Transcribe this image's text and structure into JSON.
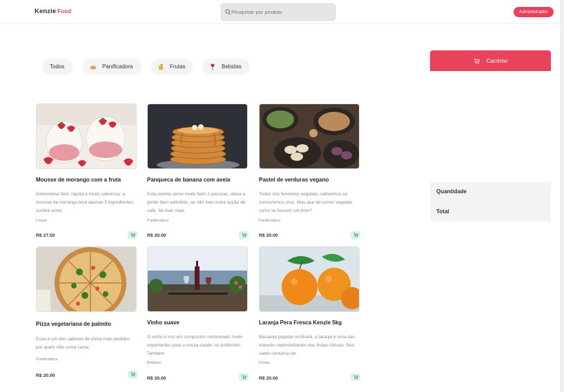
{
  "header": {
    "logo_main": "Kenzie",
    "logo_accent": "Food",
    "search_placeholder": "Pesquisar por produto",
    "admin_label": "Administrador"
  },
  "categories": [
    {
      "label": "Todos",
      "icon": ""
    },
    {
      "label": "Panificadora",
      "icon": "bread-icon"
    },
    {
      "label": "Frutas",
      "icon": "fruit-icon"
    },
    {
      "label": "Bebidas",
      "icon": "wine-icon"
    }
  ],
  "cart": {
    "title": "Carrinho",
    "quantity_label": "Quantidade",
    "total_label": "Total"
  },
  "products": [
    {
      "name": "Mousse de morango com a fruta",
      "description": "Sobremesa fácil, rápida e muito saborosa: a mousse de morango leva apenas 5 ingredientes; confira como",
      "category": "Frutas",
      "price": "R$ 27.50",
      "image": "strawberry-mousse"
    },
    {
      "name": "Panqueca de banana com aveia",
      "description": "Esta receita serve muito bem 2 pessoas, deixa a gente bem satisfeito, se não tiver outra opção de café. Se tiver mais",
      "category": "Panificadora",
      "price": "R$ 20.00",
      "image": "pancakes"
    },
    {
      "name": "Pastel de verduras vegano",
      "description": "Todos nós fervemos vegetais, salteamos ou consumimos crus. Mas que tal comer vegetais como se fossem um bolo?",
      "category": "Panificadora",
      "price": "R$ 20.00",
      "image": "dumplings"
    },
    {
      "name": "Pizza vegetariana de palmito",
      "description": "Esse é um dos sabores de pizza mais pedidos por quem não come carne",
      "category": "Panificadora",
      "price": "R$ 20.00",
      "image": "pizza"
    },
    {
      "name": "Vinho suave",
      "description": "O vinho é rico em compostos nutricionais muito importantes para a nossa saúde: os polifenóis. Também",
      "category": "Bebidas",
      "price": "R$ 20.00",
      "image": "wine-table"
    },
    {
      "name": "Laranja Pera Fresca Kenzie 5kg",
      "description": "Bastante popular no Brasil, a laranja é uma das maiores representantes das frutas cítricas. Seu sabor costuma ser",
      "category": "Frutas",
      "price": "R$ 20.00",
      "image": "oranges"
    }
  ],
  "colors": {
    "accent": "#e9435c",
    "add_button_bg": "#dff0e6",
    "add_button_icon": "#27ae60"
  }
}
